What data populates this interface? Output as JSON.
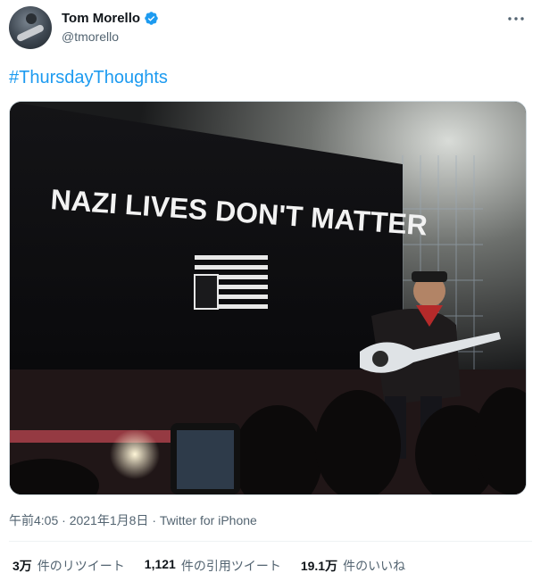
{
  "author": {
    "name": "Tom Morello",
    "handle": "@tmorello",
    "verified": true
  },
  "tweet": {
    "text": "#ThursdayThoughts",
    "image_caption_text": "NAZI LIVES DON'T MATTER"
  },
  "meta": {
    "time": "午前4:05",
    "sep": "·",
    "date": "2021年1月8日",
    "source": "Twitter for iPhone"
  },
  "stats": {
    "retweets_count": "3万",
    "retweets_label": "件のリツイート",
    "quotes_count": "1,121",
    "quotes_label": "件の引用ツイート",
    "likes_count": "19.1万",
    "likes_label": "件のいいね"
  },
  "icons": {
    "verified": "verified-badge-icon",
    "more": "more-options-icon"
  },
  "colors": {
    "accent": "#1d9bf0",
    "text": "#0f1419",
    "muted": "#536471"
  }
}
